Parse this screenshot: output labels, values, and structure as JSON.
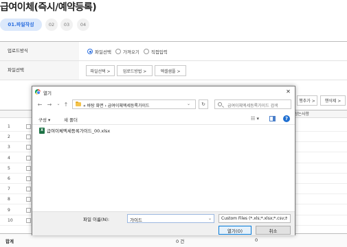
{
  "page": {
    "title": "급여이체(즉시/예약등록)",
    "steps": [
      "01.파일작성",
      "02",
      "03",
      "04"
    ]
  },
  "form": {
    "upload_method_label": "업로드방식",
    "upload_options": [
      "파일선택",
      "가져오기",
      "직접입력"
    ],
    "selected_option": "파일선택",
    "file_select_label": "파일선택",
    "file_buttons": [
      "파일선택 >",
      "업로드방법 >",
      "엑셀샘플 >"
    ]
  },
  "grid": {
    "right_buttons": [
      "행추가 >",
      "행삭제 >"
    ],
    "column_header": "참는사항",
    "row_numbers": [
      "1",
      "2",
      "3",
      "4",
      "5",
      "6",
      "7",
      "8",
      "9",
      "10"
    ],
    "total_label": "합계",
    "total_value_1": "0 건",
    "total_value_2": "0"
  },
  "dialog": {
    "title": "열기",
    "close_glyph": "✕",
    "nav": {
      "back": "←",
      "forward": "→",
      "down": "⌄",
      "up": "↑"
    },
    "address_path": "« 바탕 화면  ›  급여이체엑세등록가이드",
    "address_dropdown": "⌄",
    "refresh_glyph": "↻",
    "search_placeholder": "급여이체엑세등록가이드 검색",
    "toolbar": {
      "organize": "구성 ▾",
      "new_folder": "새 폴더",
      "view_glyph": "☷ ▾",
      "help": "?"
    },
    "files": [
      {
        "name": "급여이체엑세등록가이드_00.xlsx",
        "icon": "excel-file-icon"
      }
    ],
    "filename_label": "파일 이름(N):",
    "filename_value": "가이드",
    "filename_dropdown": "⌄",
    "filetype_value": "Custom Files (*.xls;*.xlsx;*.csv;*",
    "filetype_dropdown": "⌄",
    "open_button": "열기(O)",
    "cancel_button": "취소"
  }
}
